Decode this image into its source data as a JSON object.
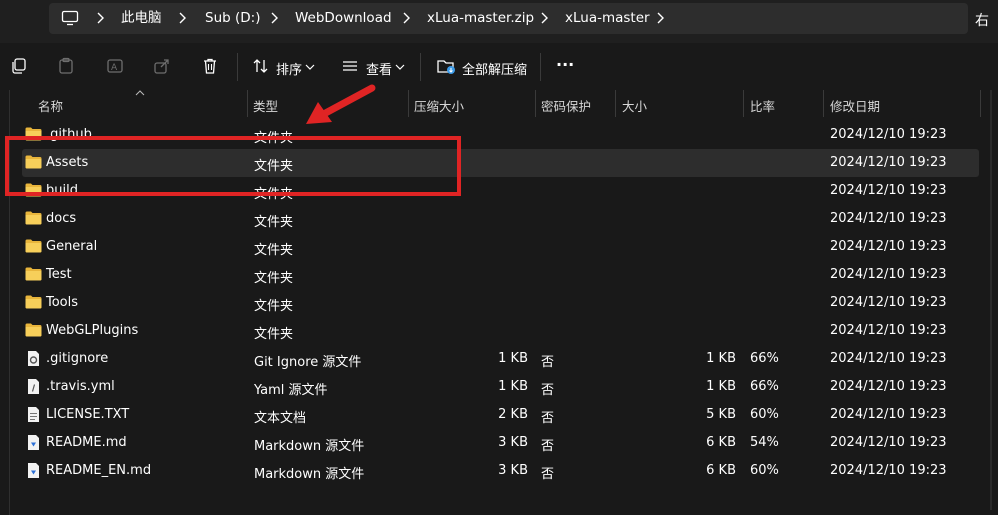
{
  "breadcrumb": [
    "此电脑",
    "Sub (D:)",
    "WebDownload",
    "xLua-master.zip",
    "xLua-master"
  ],
  "sidebar_hint": "右",
  "toolbar": {
    "sort_label": "排序",
    "view_label": "查看",
    "extract_all_label": "全部解压缩",
    "more_label": "···"
  },
  "columns": {
    "name": "名称",
    "type": "类型",
    "compressed_size": "压缩大小",
    "password": "密码保护",
    "size": "大小",
    "ratio": "比率",
    "modified": "修改日期"
  },
  "files": [
    {
      "name": ".github",
      "type": "文件夹",
      "csize": "",
      "pwd": "",
      "size": "",
      "ratio": "",
      "date": "2024/12/10 19:23",
      "icon": "folder-icon"
    },
    {
      "name": "Assets",
      "type": "文件夹",
      "csize": "",
      "pwd": "",
      "size": "",
      "ratio": "",
      "date": "2024/12/10 19:23",
      "icon": "folder-icon",
      "selected": true
    },
    {
      "name": "build",
      "type": "文件夹",
      "csize": "",
      "pwd": "",
      "size": "",
      "ratio": "",
      "date": "2024/12/10 19:23",
      "icon": "folder-icon"
    },
    {
      "name": "docs",
      "type": "文件夹",
      "csize": "",
      "pwd": "",
      "size": "",
      "ratio": "",
      "date": "2024/12/10 19:23",
      "icon": "folder-icon"
    },
    {
      "name": "General",
      "type": "文件夹",
      "csize": "",
      "pwd": "",
      "size": "",
      "ratio": "",
      "date": "2024/12/10 19:23",
      "icon": "folder-icon"
    },
    {
      "name": "Test",
      "type": "文件夹",
      "csize": "",
      "pwd": "",
      "size": "",
      "ratio": "",
      "date": "2024/12/10 19:23",
      "icon": "folder-icon"
    },
    {
      "name": "Tools",
      "type": "文件夹",
      "csize": "",
      "pwd": "",
      "size": "",
      "ratio": "",
      "date": "2024/12/10 19:23",
      "icon": "folder-icon"
    },
    {
      "name": "WebGLPlugins",
      "type": "文件夹",
      "csize": "",
      "pwd": "",
      "size": "",
      "ratio": "",
      "date": "2024/12/10 19:23",
      "icon": "folder-icon"
    },
    {
      "name": ".gitignore",
      "type": "Git Ignore 源文件",
      "csize": "1 KB",
      "pwd": "否",
      "size": "1 KB",
      "ratio": "66%",
      "date": "2024/12/10 19:23",
      "icon": "gear-file-icon"
    },
    {
      "name": ".travis.yml",
      "type": "Yaml 源文件",
      "csize": "1 KB",
      "pwd": "否",
      "size": "1 KB",
      "ratio": "66%",
      "date": "2024/12/10 19:23",
      "icon": "code-file-icon"
    },
    {
      "name": "LICENSE.TXT",
      "type": "文本文档",
      "csize": "2 KB",
      "pwd": "否",
      "size": "5 KB",
      "ratio": "60%",
      "date": "2024/12/10 19:23",
      "icon": "text-file-icon"
    },
    {
      "name": "README.md",
      "type": "Markdown 源文件",
      "csize": "3 KB",
      "pwd": "否",
      "size": "6 KB",
      "ratio": "54%",
      "date": "2024/12/10 19:23",
      "icon": "markdown-file-icon"
    },
    {
      "name": "README_EN.md",
      "type": "Markdown 源文件",
      "csize": "3 KB",
      "pwd": "否",
      "size": "6 KB",
      "ratio": "60%",
      "date": "2024/12/10 19:23",
      "icon": "markdown-file-icon"
    }
  ],
  "colors": {
    "highlight_box": "#e02424",
    "folder": "#f4c542",
    "selected_row": "#2d2d2d"
  }
}
